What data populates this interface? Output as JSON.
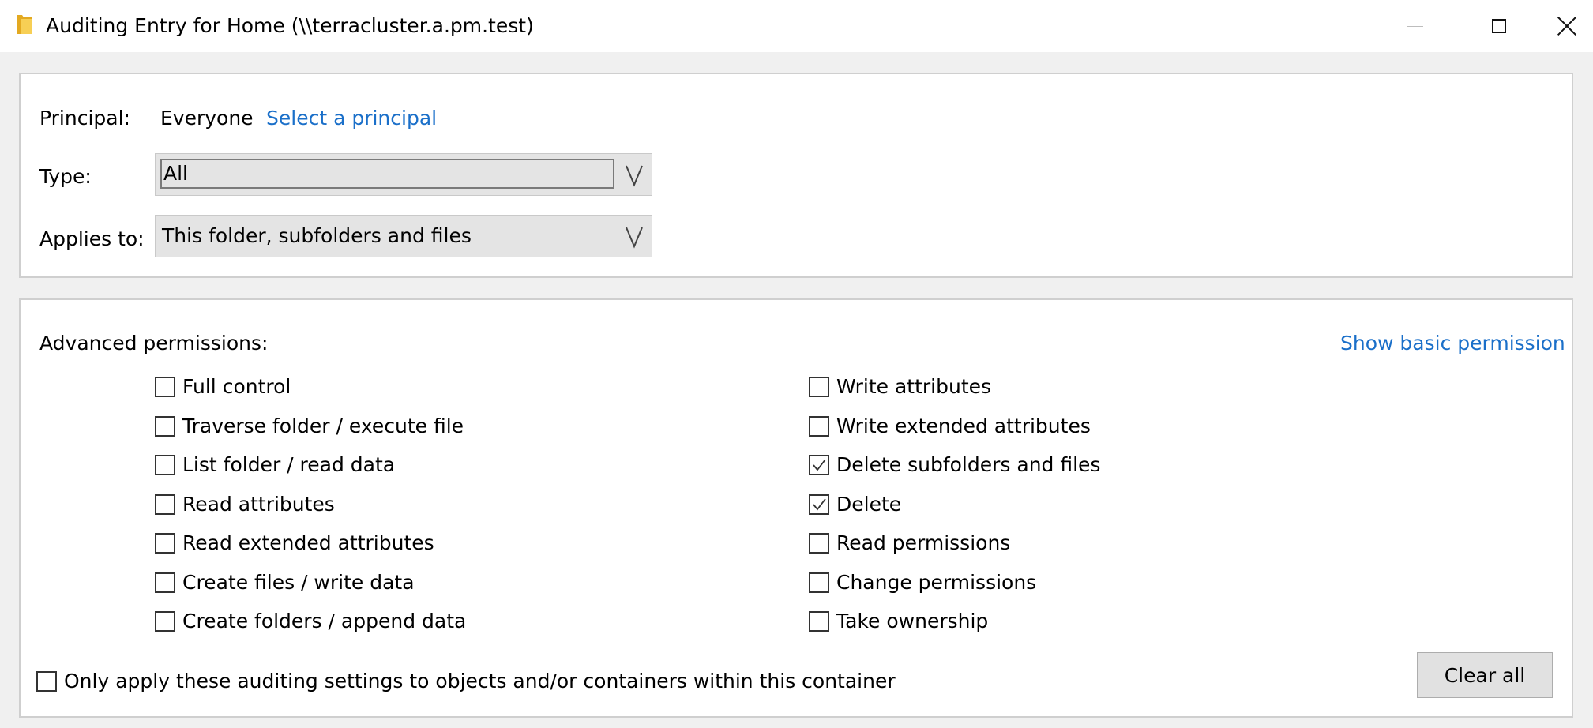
{
  "window": {
    "title": "Auditing Entry for Home (\\\\terracluster.a.pm.test)",
    "icon": "folder-icon"
  },
  "principal": {
    "label": "Principal:",
    "value": "Everyone",
    "select_link": "Select a principal"
  },
  "type": {
    "label": "Type:",
    "value": "All"
  },
  "applies_to": {
    "label": "Applies to:",
    "value": "This folder, subfolders and files"
  },
  "permissions": {
    "heading": "Advanced permissions:",
    "show_basic_link": "Show basic permission",
    "left": [
      {
        "label": "Full control",
        "checked": false
      },
      {
        "label": "Traverse folder / execute file",
        "checked": false
      },
      {
        "label": "List folder / read data",
        "checked": false
      },
      {
        "label": "Read attributes",
        "checked": false
      },
      {
        "label": "Read extended attributes",
        "checked": false
      },
      {
        "label": "Create files / write data",
        "checked": false
      },
      {
        "label": "Create folders / append data",
        "checked": false
      }
    ],
    "right": [
      {
        "label": "Write attributes",
        "checked": false
      },
      {
        "label": "Write extended attributes",
        "checked": false
      },
      {
        "label": "Delete subfolders and files",
        "checked": true
      },
      {
        "label": "Delete",
        "checked": true
      },
      {
        "label": "Read permissions",
        "checked": false
      },
      {
        "label": "Change permissions",
        "checked": false
      },
      {
        "label": "Take ownership",
        "checked": false
      }
    ]
  },
  "only_apply": {
    "label": "Only apply these auditing settings to objects and/or containers within this container",
    "checked": false
  },
  "clear_all_label": "Clear all",
  "colors": {
    "link": "#1a6fc9",
    "folder_yellow": "#f5c542"
  }
}
